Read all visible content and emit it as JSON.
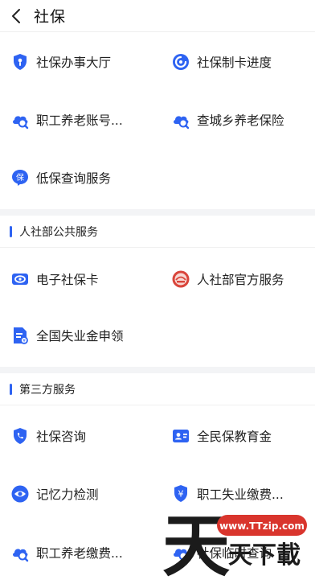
{
  "header": {
    "title": "社保"
  },
  "section1": {
    "items": [
      {
        "label": "社保办事大厅",
        "icon": "shield-icon"
      },
      {
        "label": "社保制卡进度",
        "icon": "progress-icon"
      },
      {
        "label": "职工养老账号...",
        "icon": "search-cloud-icon"
      },
      {
        "label": "查城乡养老保险",
        "icon": "search-cloud-icon"
      },
      {
        "label": "低保查询服务",
        "icon": "bao-badge-icon"
      }
    ]
  },
  "section2": {
    "title": "人社部公共服务",
    "items": [
      {
        "label": "电子社保卡",
        "icon": "card-icon"
      },
      {
        "label": "人社部官方服务",
        "icon": "official-emblem-icon"
      },
      {
        "label": "全国失业金申领",
        "icon": "document-icon"
      }
    ]
  },
  "section3": {
    "title": "第三方服务",
    "items": [
      {
        "label": "社保咨询",
        "icon": "shield-phone-icon"
      },
      {
        "label": "全民保教育金",
        "icon": "id-card-icon"
      },
      {
        "label": "记忆力检测",
        "icon": "eye-shield-icon"
      },
      {
        "label": "职工失业缴费...",
        "icon": "yuan-icon"
      },
      {
        "label": "职工养老缴费...",
        "icon": "search-cloud-icon"
      },
      {
        "label": "社保临时查询",
        "icon": "search-cloud-icon"
      }
    ]
  },
  "watermark": {
    "big": "天",
    "site": "www.TTzip.com",
    "sub": "天下載"
  },
  "colors": {
    "accent": "#2e63f2",
    "divider": "#f3f4f6",
    "emblem": "#d9453b"
  }
}
